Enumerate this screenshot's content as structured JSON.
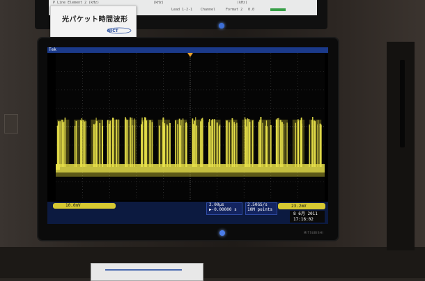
{
  "sign": {
    "title": "光パケット時間波形",
    "logo": "NICT"
  },
  "top_screen": {
    "items": [
      "P Line Element 2 (kHz)",
      "(kHz)",
      "(kHz)",
      "Lead 1-2-1",
      "Channel",
      "Format 2",
      "0.0"
    ]
  },
  "oscilloscope": {
    "brand": "Tek",
    "channel_label": "10.0mV",
    "timebase": "2.00μs",
    "trigger_offset": "▶-0.00000 s",
    "sample_rate": "2.50GS/s",
    "record_length": "10M points",
    "trigger_level": "23.2mV",
    "date": "8 6月 2011",
    "time": "17:16:02"
  },
  "monitor": {
    "brand": "MITSUBISHI"
  },
  "colors": {
    "trace": "#e8e14a",
    "trace_dim": "#b5ad2c",
    "status_bar": "#1b3a8a",
    "badge": "#d6c832"
  }
}
